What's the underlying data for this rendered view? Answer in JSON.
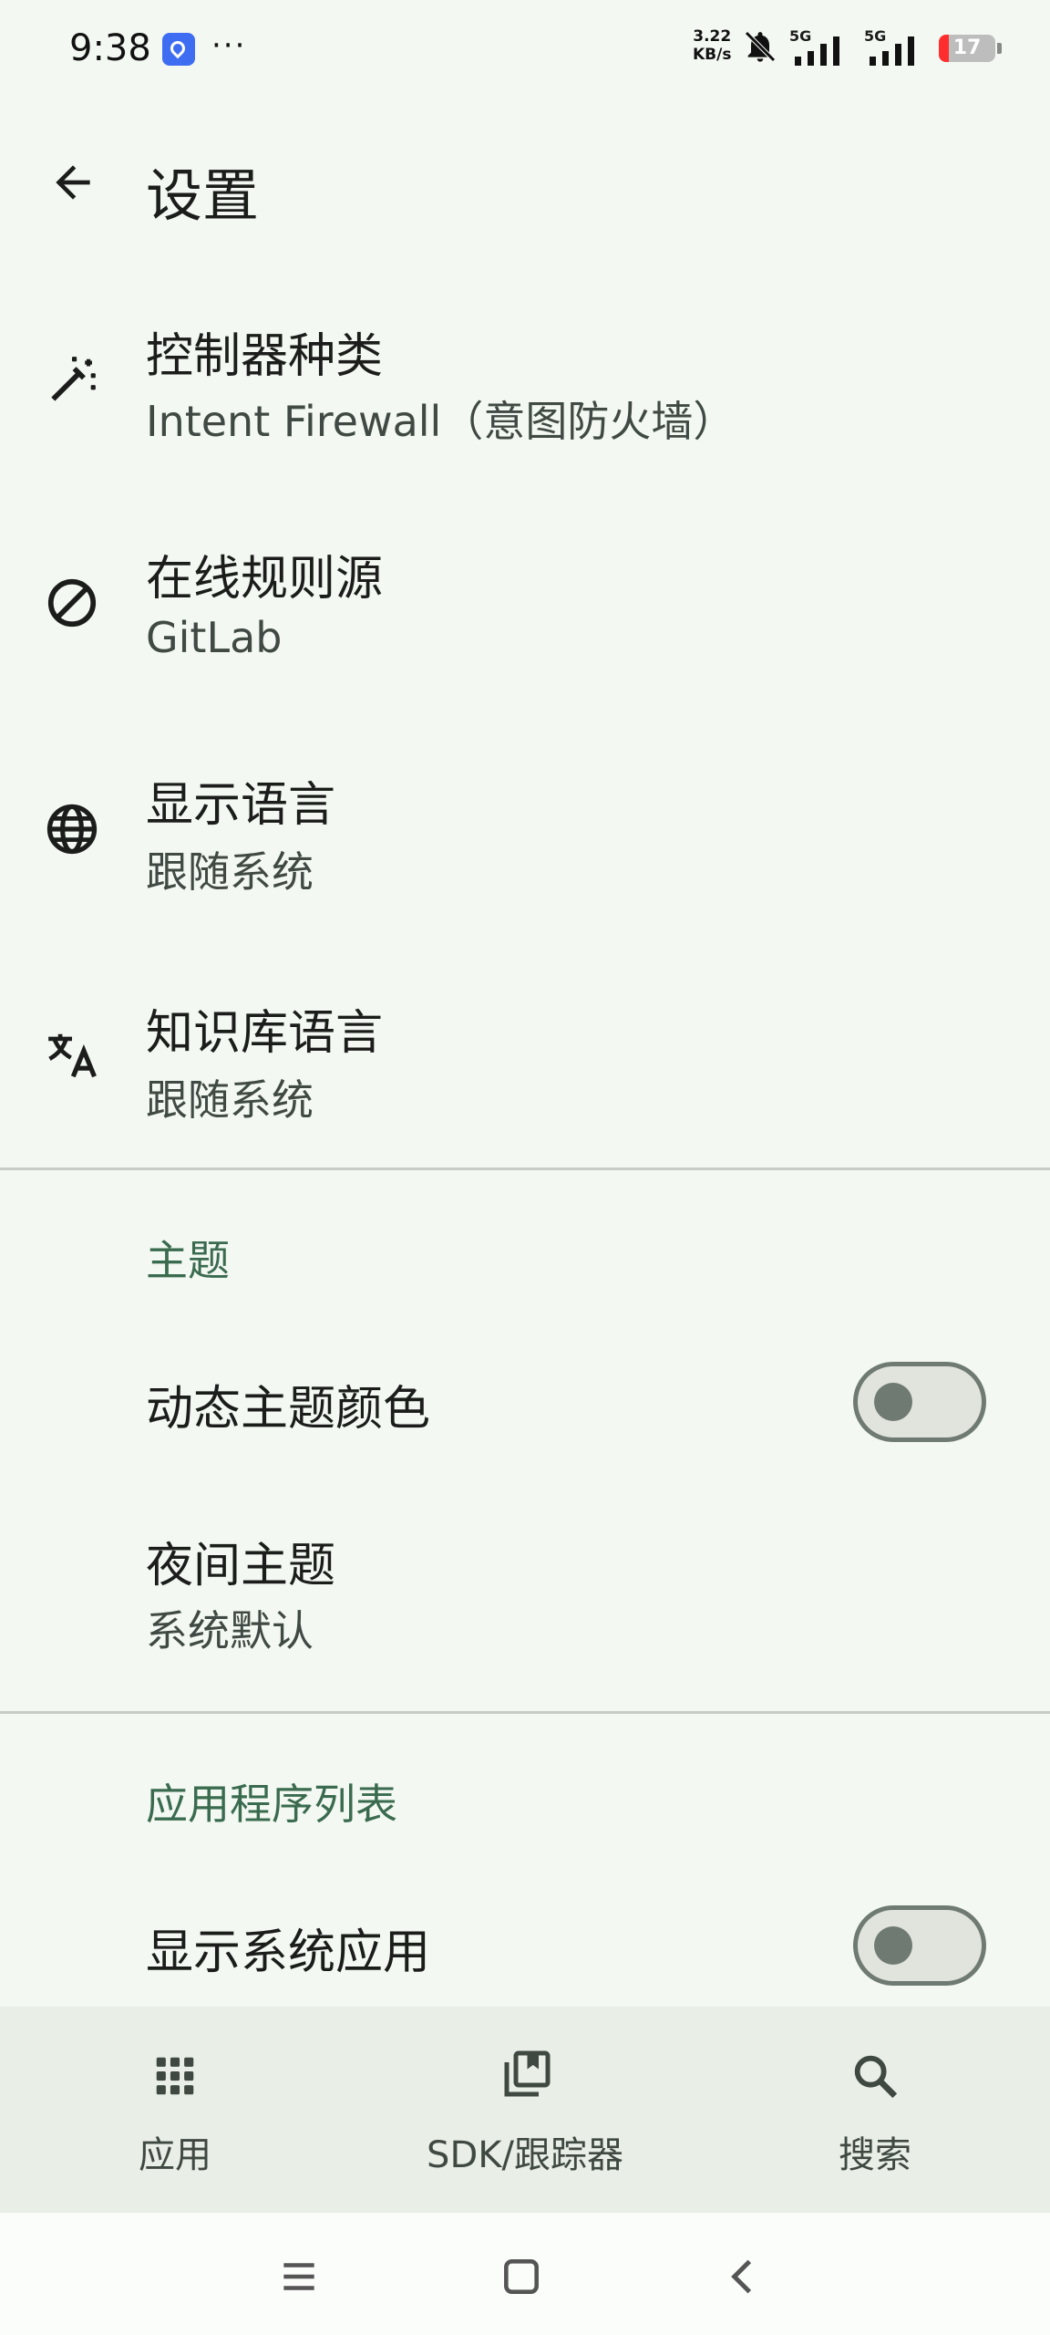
{
  "status_bar": {
    "time": "9:38",
    "more": "···",
    "net_speed_value": "3.22",
    "net_speed_unit": "KB/s",
    "signal1": "5G",
    "signal2": "5G",
    "battery": "17",
    "icons": [
      "app-notification-icon",
      "bell-muted-icon",
      "signal-icon",
      "battery-icon"
    ]
  },
  "header": {
    "title": "设置"
  },
  "general": [
    {
      "title": "控制器种类",
      "subtitle": "Intent Firewall（意图防火墙）",
      "icon": "magic-wand-icon"
    },
    {
      "title": "在线规则源",
      "subtitle": "GitLab",
      "icon": "block-icon"
    },
    {
      "title": "显示语言",
      "subtitle": "跟随系统",
      "icon": "globe-icon"
    },
    {
      "title": "知识库语言",
      "subtitle": "跟随系统",
      "icon": "translate-icon"
    }
  ],
  "theme": {
    "header": "主题",
    "dynamic_color": {
      "label": "动态主题颜色",
      "enabled": false
    },
    "dark_theme": {
      "title": "夜间主题",
      "subtitle": "系统默认"
    }
  },
  "app_list": {
    "header": "应用程序列表",
    "show_system_apps": {
      "label": "显示系统应用",
      "enabled": false
    }
  },
  "bottom_nav": [
    {
      "label": "应用",
      "icon": "apps-grid-icon"
    },
    {
      "label": "SDK/跟踪器",
      "icon": "library-icon"
    },
    {
      "label": "搜索",
      "icon": "search-icon"
    }
  ],
  "colors": {
    "background": "#f3f8f2",
    "accent": "#3a6b4f",
    "nav_background": "#e9eee7"
  }
}
